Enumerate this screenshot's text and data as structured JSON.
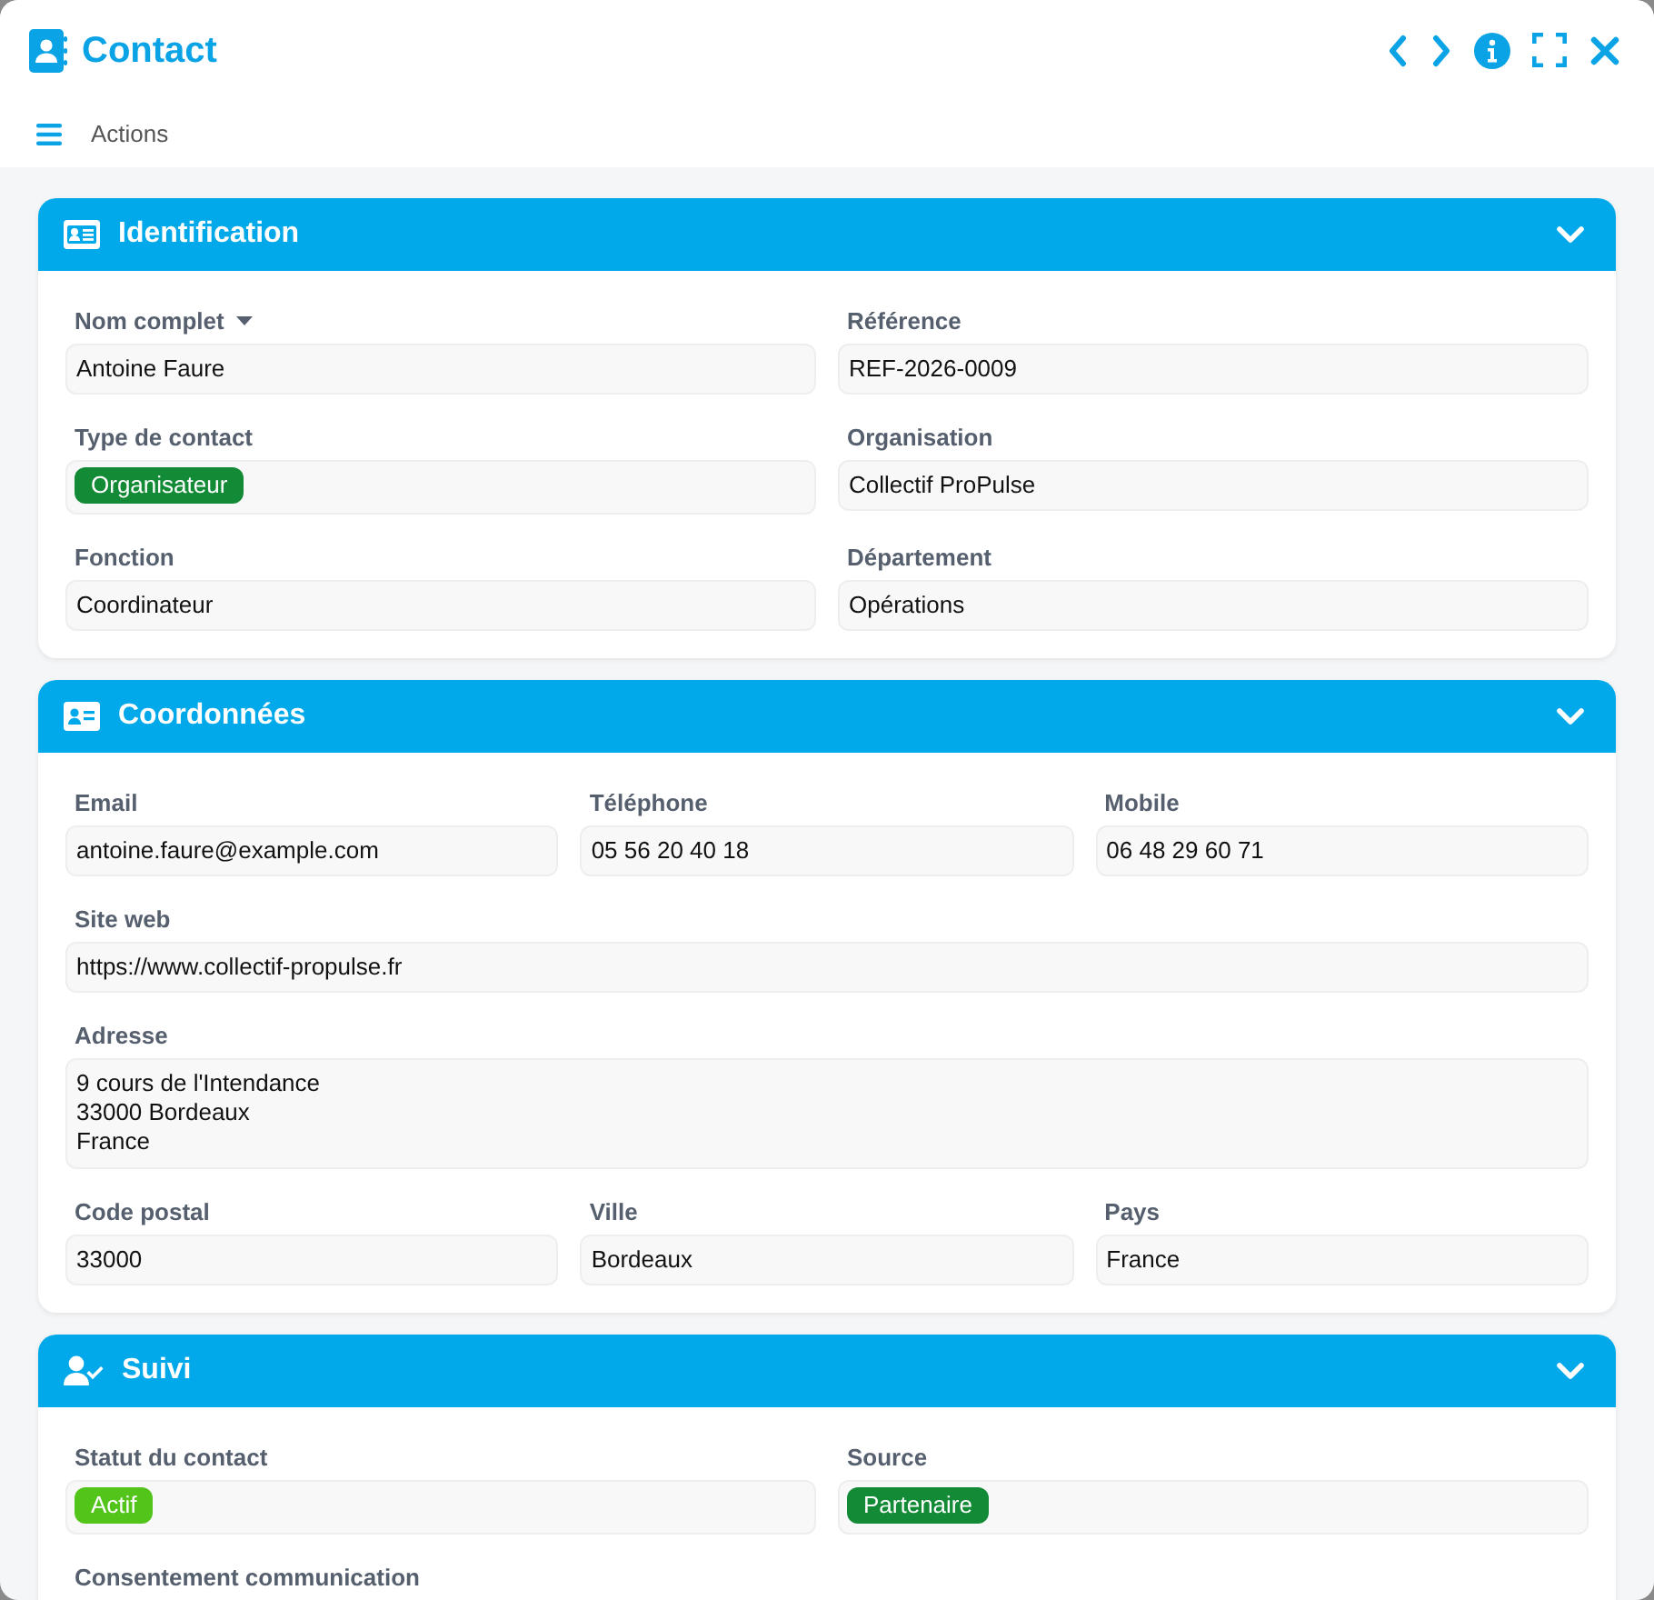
{
  "window": {
    "title": "Contact"
  },
  "toolbar": {
    "menu_label": "Actions"
  },
  "sections": [
    {
      "title": "Identification",
      "expanded": true,
      "rows": [
        [
          {
            "label": "Nom complet",
            "has_menu": true,
            "kind": "text",
            "value": "Antoine Faure"
          },
          {
            "label": "Référence",
            "kind": "text",
            "value": "REF-2026-0009"
          }
        ],
        [
          {
            "label": "Type de contact",
            "kind": "tag",
            "value": "Organisateur",
            "color": "#138a36"
          },
          {
            "label": "Organisation",
            "kind": "text",
            "value": "Collectif ProPulse"
          }
        ],
        [
          {
            "label": "Fonction",
            "kind": "text",
            "value": "Coordinateur"
          },
          {
            "label": "Département",
            "kind": "text",
            "value": "Opérations"
          }
        ]
      ]
    },
    {
      "title": "Coordonnées",
      "expanded": true,
      "rows": [
        [
          {
            "label": "Email",
            "kind": "text",
            "value": "antoine.faure@example.com"
          },
          {
            "label": "Téléphone",
            "kind": "text",
            "value": "05 56 20 40 18"
          },
          {
            "label": "Mobile",
            "kind": "text",
            "value": "06 48 29 60 71"
          }
        ],
        [
          {
            "label": "Site web",
            "kind": "text",
            "value": "https://www.collectif-propulse.fr"
          }
        ],
        [
          {
            "label": "Adresse",
            "kind": "multiline",
            "lines": [
              "9 cours de l'Intendance",
              "33000 Bordeaux",
              "France"
            ]
          }
        ],
        [
          {
            "label": "Code postal",
            "kind": "text",
            "value": "33000"
          },
          {
            "label": "Ville",
            "kind": "text",
            "value": "Bordeaux"
          },
          {
            "label": "Pays",
            "kind": "text",
            "value": "France"
          }
        ]
      ]
    },
    {
      "title": "Suivi",
      "expanded": true,
      "rows": [
        [
          {
            "label": "Statut du contact",
            "kind": "tag",
            "value": "Actif",
            "color": "#52c41a"
          },
          {
            "label": "Source",
            "kind": "tag",
            "value": "Partenaire",
            "color": "#138a36"
          }
        ],
        [
          {
            "label": "Consentement communication",
            "kind": "label"
          }
        ]
      ]
    }
  ]
}
